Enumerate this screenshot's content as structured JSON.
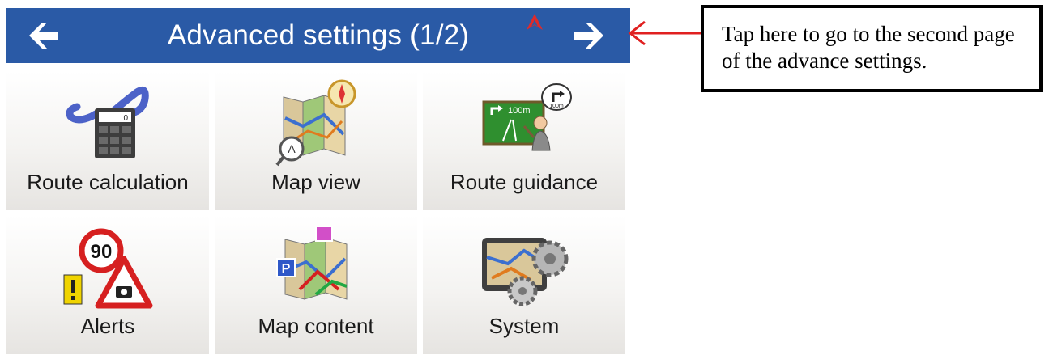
{
  "header": {
    "title": "Advanced settings (1/2)",
    "back_icon": "arrow-left-icon",
    "next_icon": "arrow-right-icon",
    "status_icon": "gps-warning-icon",
    "bar_color": "#2a5aa6"
  },
  "tiles": [
    {
      "label": "Route calculation",
      "icon": "route-calculator-icon"
    },
    {
      "label": "Map view",
      "icon": "map-view-icon"
    },
    {
      "label": "Route guidance",
      "icon": "route-guidance-icon"
    },
    {
      "label": "Alerts",
      "icon": "speed-alert-icon"
    },
    {
      "label": "Map content",
      "icon": "map-content-icon"
    },
    {
      "label": "System",
      "icon": "system-gears-icon"
    }
  ],
  "callout": {
    "text": "Tap here to go to the second page of the advance settings.",
    "arrow_color": "#e02020"
  }
}
